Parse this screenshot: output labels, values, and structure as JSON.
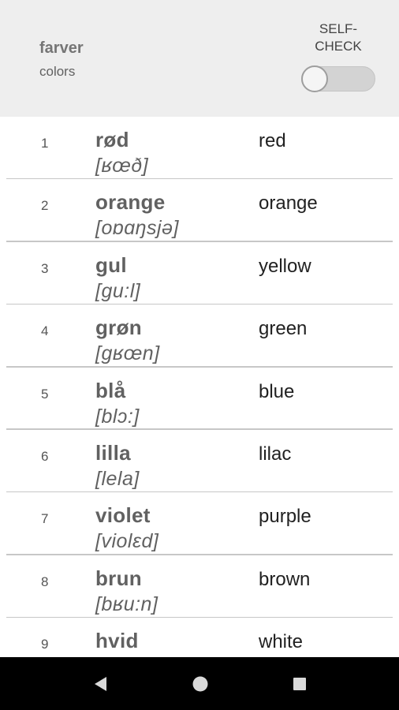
{
  "header": {
    "title": "farver",
    "subtitle": "colors",
    "selfcheck_label": "SELF-\nCHECK",
    "selfcheck_on": false
  },
  "rows": [
    {
      "num": "1",
      "word": "rød",
      "ipa": "[ʁœð]",
      "translation": "red"
    },
    {
      "num": "2",
      "word": "orange",
      "ipa": "[oɒɑŋsjə]",
      "translation": "orange"
    },
    {
      "num": "3",
      "word": "gul",
      "ipa": "[gu:l]",
      "translation": "yellow"
    },
    {
      "num": "4",
      "word": "grøn",
      "ipa": "[gʁœn]",
      "translation": "green"
    },
    {
      "num": "5",
      "word": "blå",
      "ipa": "[blɔ:]",
      "translation": "blue"
    },
    {
      "num": "6",
      "word": "lilla",
      "ipa": "[lela]",
      "translation": "lilac"
    },
    {
      "num": "7",
      "word": "violet",
      "ipa": "[violɛd]",
      "translation": "purple"
    },
    {
      "num": "8",
      "word": "brun",
      "ipa": "[bʁu:n]",
      "translation": "brown"
    },
    {
      "num": "9",
      "word": "hvid",
      "ipa": "",
      "translation": "white"
    }
  ],
  "navbar": {
    "back_icon": "back-triangle-icon",
    "home_icon": "home-circle-icon",
    "recent_icon": "recent-square-icon"
  }
}
